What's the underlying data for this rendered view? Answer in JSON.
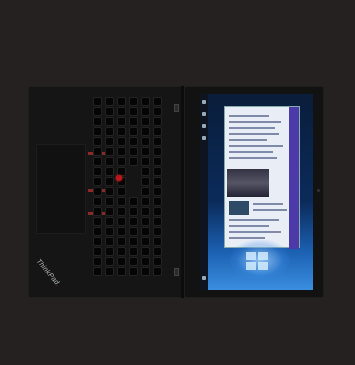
{
  "photo": {
    "subject": "laptop",
    "logo_text": "ThinkPad",
    "colors": {
      "background": "#252120",
      "chassis": "#151515",
      "accent_red": "#c0141a",
      "screen_blue": "#1b5fb0"
    }
  }
}
